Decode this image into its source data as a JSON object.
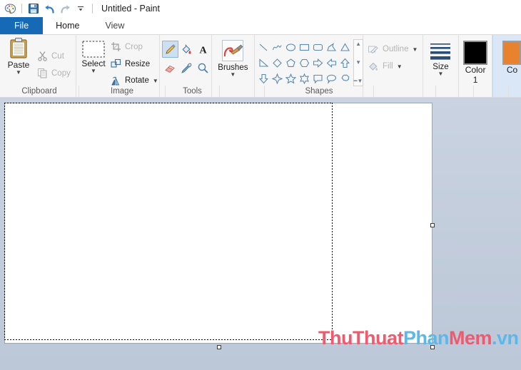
{
  "window": {
    "title": "Untitled - Paint",
    "quick_access": [
      {
        "name": "paint-app-icon",
        "label": "Paint"
      },
      {
        "name": "save-icon",
        "label": "Save"
      },
      {
        "name": "undo-icon",
        "label": "Undo"
      },
      {
        "name": "redo-icon",
        "label": "Redo"
      },
      {
        "name": "customize-qat-icon",
        "label": "Customize Quick Access Toolbar"
      }
    ]
  },
  "tabs": [
    {
      "label": "File",
      "state": "file"
    },
    {
      "label": "Home",
      "state": "active"
    },
    {
      "label": "View",
      "state": "inactive"
    }
  ],
  "ribbon": {
    "groups": [
      {
        "label": "Clipboard"
      },
      {
        "label": "Image"
      },
      {
        "label": "Tools"
      },
      {
        "label": ""
      },
      {
        "label": "Shapes"
      },
      {
        "label": ""
      },
      {
        "label": ""
      }
    ],
    "clipboard": {
      "paste_label": "Paste",
      "cut_label": "Cut",
      "copy_label": "Copy"
    },
    "image": {
      "select_label": "Select",
      "crop_label": "Crop",
      "resize_label": "Resize",
      "rotate_label": "Rotate"
    },
    "tools": {
      "items": [
        {
          "name": "pencil-tool",
          "selected": true
        },
        {
          "name": "fill-with-color-tool",
          "selected": false
        },
        {
          "name": "text-tool",
          "selected": false
        },
        {
          "name": "eraser-tool",
          "selected": false
        },
        {
          "name": "color-picker-tool",
          "selected": false
        },
        {
          "name": "magnifier-tool",
          "selected": false
        }
      ]
    },
    "brushes": {
      "label": "Brushes"
    },
    "shapes": {
      "items": [
        "line",
        "curve",
        "oval",
        "rectangle",
        "rounded-rectangle",
        "polygon",
        "triangle",
        "right-triangle",
        "diamond",
        "pentagon",
        "hexagon",
        "right-arrow",
        "left-arrow",
        "up-arrow",
        "down-arrow",
        "four-point-star",
        "five-point-star",
        "six-point-star",
        "rounded-callout",
        "oval-callout",
        "cloud-callout"
      ],
      "scroll_up": "▲",
      "scroll_down": "▼",
      "scroll_more": "▼"
    },
    "outline_fill": {
      "outline_label": "Outline",
      "fill_label": "Fill"
    },
    "size": {
      "label": "Size"
    },
    "color1": {
      "label": "Color",
      "sublabel": "1",
      "value": "#000000"
    },
    "color2": {
      "label": "Co",
      "value": "#e8822e"
    }
  },
  "canvas": {
    "selection_active": true,
    "handles": [
      "right-middle",
      "bottom-center",
      "bottom-right"
    ]
  },
  "watermark": {
    "parts": [
      {
        "text": "ThuThuat",
        "color": "red"
      },
      {
        "text": "Phan",
        "color": "blue"
      },
      {
        "text": "Mem",
        "color": "red"
      },
      {
        "text": ".vn",
        "color": "blue"
      }
    ]
  }
}
